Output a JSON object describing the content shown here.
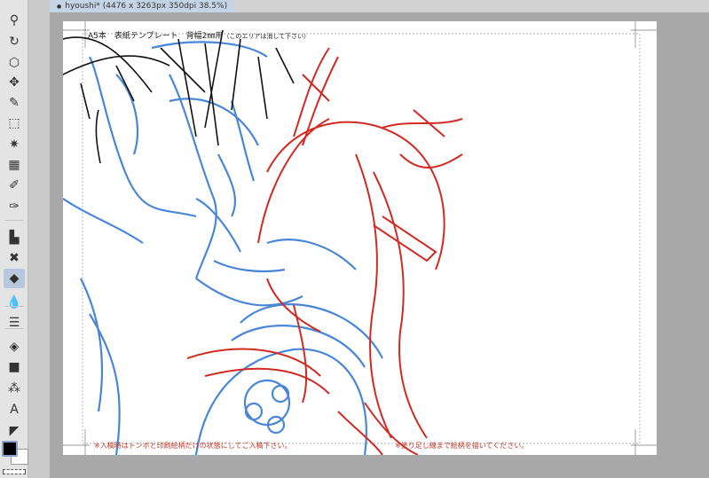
{
  "tab": {
    "title": "hyoushi* (4476 x 3263px 350dpi 38.5%)",
    "modified_dot": "●"
  },
  "toolbar": {
    "tools": [
      {
        "name": "zoom",
        "glyph": "⚲"
      },
      {
        "name": "rotate",
        "glyph": "↻"
      },
      {
        "name": "object",
        "glyph": "⬡"
      },
      {
        "name": "move",
        "glyph": "✥"
      },
      {
        "name": "eyedropper",
        "glyph": "✎"
      },
      {
        "name": "selection",
        "glyph": "⬚"
      },
      {
        "name": "auto-select",
        "glyph": "✷"
      },
      {
        "name": "pattern",
        "glyph": "▦"
      },
      {
        "name": "pen",
        "glyph": "✐"
      },
      {
        "name": "pencil",
        "glyph": "✑"
      },
      {
        "name": "brush",
        "glyph": "▙"
      },
      {
        "name": "decoration",
        "glyph": "✖"
      },
      {
        "name": "eraser",
        "glyph": "◆"
      },
      {
        "name": "blend",
        "glyph": "💧"
      },
      {
        "name": "figure",
        "glyph": "☰"
      },
      {
        "name": "fill",
        "glyph": "◈"
      },
      {
        "name": "gradient",
        "glyph": "■"
      },
      {
        "name": "frame",
        "glyph": "⁂"
      },
      {
        "name": "text",
        "glyph": "A"
      },
      {
        "name": "balloon",
        "glyph": "◤"
      }
    ],
    "active_tool": "eraser",
    "main_color": "#000000",
    "sub_color": "#ffffff"
  },
  "canvas": {
    "header_text": "A5本　表紙テンプレート　背幅2㎜用",
    "header_note": "（このエリアは消して下さい）",
    "footer_left": "※入稿時はトンボと印刷絵柄だけの状態にしてご入稿下さい。",
    "footer_right": "※塗り足し線まで絵柄を描いてください。",
    "colors": {
      "blue_sketch": "#4a86d8",
      "red_sketch": "#d22a22",
      "black_lines": "#111111",
      "note_red": "#c0392b"
    }
  }
}
